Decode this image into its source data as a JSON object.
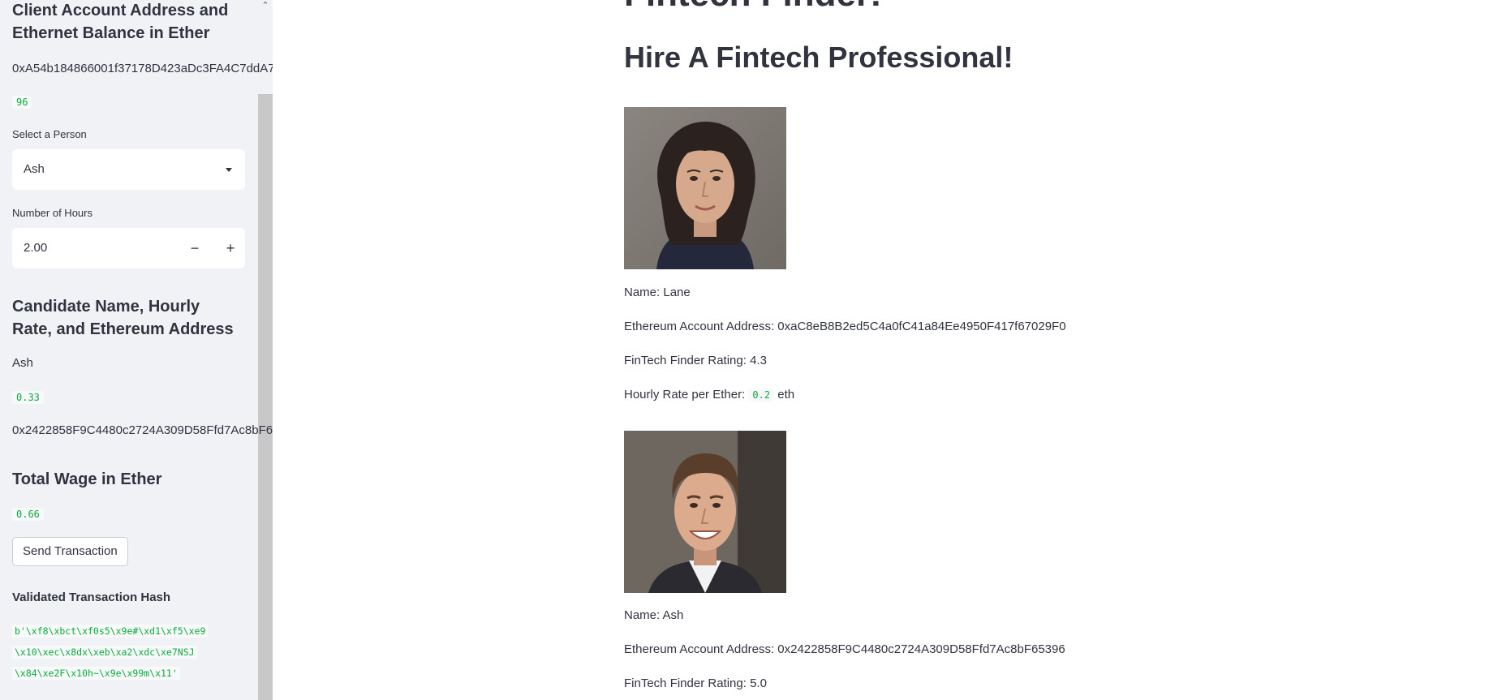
{
  "sidebar": {
    "account_heading": "Client Account Address and Ethernet Balance in Ether",
    "account_address": "0xA54b184866001f37178D423aDc3FA4C7ddA7",
    "balance": "96",
    "select_label": "Select a Person",
    "selected_person": "Ash",
    "hours_label": "Number of Hours",
    "hours_value": "2.00",
    "minus_label": "−",
    "plus_label": "+",
    "candidate_heading": "Candidate Name, Hourly Rate, and Ethereum Address",
    "candidate_name": "Ash",
    "candidate_rate": "0.33",
    "candidate_address": "0x2422858F9C4480c2724A309D58Ffd7Ac8bF6",
    "total_wage_heading": "Total Wage in Ether",
    "total_wage": "0.66",
    "send_button": "Send Transaction",
    "hash_heading": "Validated Transaction Hash",
    "hash_lines": [
      "b'\\xf8\\xbct\\xf0s5\\x9e#\\xd1\\xf5\\xe9",
      "\\x10\\xec\\x8dx\\xeb\\xa2\\xdc\\xe7NSJ",
      "\\x84\\xe2F\\x10h~\\x9e\\x99m\\x11'"
    ]
  },
  "main": {
    "title": "Fintech Finder!",
    "subtitle": "Hire A Fintech Professional!",
    "candidates": [
      {
        "name": "Name: Lane",
        "address": "Ethereum Account Address: 0xaC8eB8B2ed5C4a0fC41a84Ee4950F417f67029F0",
        "rating": "FinTech Finder Rating: 4.3",
        "rate_prefix": "Hourly Rate per Ether: ",
        "rate_value": "0.2",
        "rate_suffix": " eth"
      },
      {
        "name": "Name: Ash",
        "address": "Ethereum Account Address: 0x2422858F9C4480c2724A309D58Ffd7Ac8bF65396",
        "rating": "FinTech Finder Rating: 5.0"
      }
    ]
  }
}
